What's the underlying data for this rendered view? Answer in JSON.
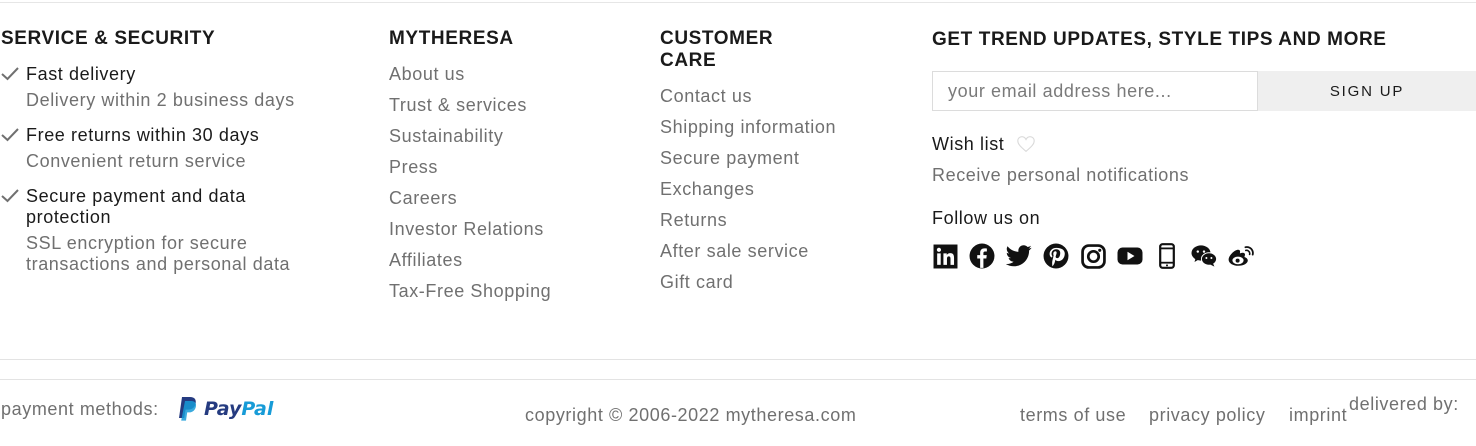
{
  "service": {
    "title": "SERVICE & SECURITY",
    "items": [
      {
        "heading": "Fast delivery",
        "sub": "Delivery within 2 business days"
      },
      {
        "heading": "Free returns within 30 days",
        "sub": "Convenient return service"
      },
      {
        "heading": "Secure payment and data protection",
        "sub": "SSL encryption for secure transactions and personal data"
      }
    ]
  },
  "mytheresa": {
    "title": "MYTHERESA",
    "links": [
      "About us",
      "Trust & services",
      "Sustainability",
      "Press",
      "Careers",
      "Investor Relations",
      "Affiliates",
      "Tax-Free Shopping"
    ]
  },
  "customer_care": {
    "title": "CUSTOMER CARE",
    "links": [
      "Contact us",
      "Shipping information",
      "Secure payment",
      "Exchanges",
      "Returns",
      "After sale service",
      "Gift card"
    ]
  },
  "newsletter": {
    "title": "GET TREND UPDATES, STYLE TIPS AND MORE",
    "placeholder": "your email address here...",
    "button": "SIGN UP"
  },
  "wishlist": {
    "label": "Wish list",
    "note": "Receive personal notifications"
  },
  "follow": {
    "label": "Follow us on",
    "icons": [
      "linkedin-icon",
      "facebook-icon",
      "twitter-icon",
      "pinterest-icon",
      "instagram-icon",
      "youtube-icon",
      "mobile-app-icon",
      "wechat-icon",
      "weibo-icon"
    ]
  },
  "footer": {
    "payment_label": "payment methods:",
    "paypal_pay": "Pay",
    "paypal_pal": "Pal",
    "copyright": "copyright © 2006-2022 mytheresa.com",
    "terms": "terms of use",
    "privacy": "privacy policy",
    "imprint": "imprint",
    "delivered_by": "delivered by:"
  },
  "colors": {
    "text": "#1a1a1a",
    "muted": "#707070",
    "button_bg": "#efefef",
    "paypal_dark": "#253b80",
    "paypal_light": "#179bd7"
  }
}
